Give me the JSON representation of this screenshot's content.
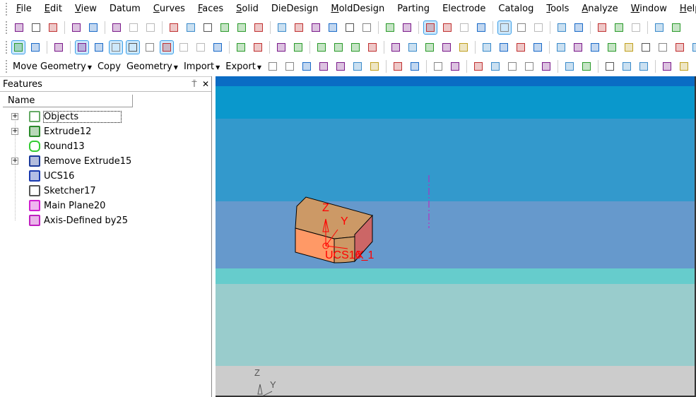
{
  "menu": [
    {
      "label": "File",
      "u": "F",
      "rest": "ile"
    },
    {
      "label": "Edit",
      "u": "E",
      "rest": "dit"
    },
    {
      "label": "View",
      "u": "V",
      "rest": "iew"
    },
    {
      "label": "Datum",
      "u": "",
      "rest": "Datum"
    },
    {
      "label": "Curves",
      "u": "C",
      "rest": "urves"
    },
    {
      "label": "Faces",
      "u": "F",
      "rest": "aces"
    },
    {
      "label": "Solid",
      "u": "S",
      "rest": "olid"
    },
    {
      "label": "DieDesign",
      "u": "",
      "rest": "DieDesign"
    },
    {
      "label": "MoldDesign",
      "u": "M",
      "rest": "oldDesign"
    },
    {
      "label": "Parting",
      "u": "",
      "rest": "Parting"
    },
    {
      "label": "Electrode",
      "u": "",
      "rest": "Electrode"
    },
    {
      "label": "Catalog",
      "u": "",
      "rest": "Catalog"
    },
    {
      "label": "Tools",
      "u": "T",
      "rest": "ools"
    },
    {
      "label": "Analyze",
      "u": "A",
      "rest": "nalyze"
    },
    {
      "label": "Window",
      "u": "W",
      "rest": "indow"
    },
    {
      "label": "Help",
      "u": "H",
      "rest": "elp"
    }
  ],
  "toolbar_row1": [
    "new-file",
    "open-folder",
    "save",
    "sep",
    "undo",
    "redo",
    "sep",
    "view-link",
    "copy-gray",
    "delete-gray",
    "sep",
    "zoom-window",
    "zoom-select",
    "zoom-in",
    "zoom",
    "pan",
    "rotate",
    "sep",
    "shaded-purple",
    "wire-purple",
    "solid-purple",
    "wire",
    "wire-2",
    "wire-3",
    "sep",
    "lock-view",
    "camera",
    "sep",
    "box-active",
    "box-green",
    "box-gray",
    "box-select",
    "sep",
    "light-active",
    "bulb-yellow",
    "bulb-gray",
    "sep",
    "arrow-left",
    "arrow-right",
    "sep",
    "points",
    "dimension",
    "view-gray",
    "sep",
    "color-table",
    "paint"
  ],
  "toolbar_row2": [
    "select-box",
    "deselect",
    "sep",
    "select-window",
    "sep",
    "filter-face",
    "filter-edge",
    "filter-surface",
    "filter-curve",
    "filter-point",
    "filter-plane",
    "filter-gray",
    "filter-gray-2",
    "list",
    "sep",
    "ucs",
    "funnel",
    "sep",
    "sketch",
    "profile",
    "sep",
    "point",
    "line",
    "arc",
    "circle",
    "sep",
    "fillet",
    "trim",
    "extend",
    "cut",
    "split",
    "sep",
    "project",
    "cylinder",
    "wrap",
    "offset",
    "sep",
    "g1",
    "g2",
    "g3",
    "g4",
    "g5",
    "g6",
    "g7",
    "g8",
    "g9"
  ],
  "toolbar_row3": {
    "labels": [
      "Move Geometry",
      "Copy",
      "Geometry",
      "Import",
      "Export"
    ],
    "icons": [
      "sweep",
      "loft",
      "surface",
      "ruled",
      "extrude-surf",
      "plane-surf",
      "draft",
      "sep",
      "mirror",
      "mirror-2",
      "sep",
      "split-face",
      "split-face-2",
      "sep",
      "box-dots",
      "box-edit",
      "patch",
      "fill",
      "offset-surface",
      "sep",
      "extrude-add",
      "extrude-add-2",
      "sep",
      "shell",
      "thicken",
      "cavity",
      "sep",
      "round",
      "chamfer",
      "face-move",
      "sep",
      "blend",
      "blend-2"
    ]
  },
  "panel": {
    "title": "Features",
    "pin": "⍑",
    "close": "✕",
    "column": "Name"
  },
  "features": [
    {
      "label": "Objects",
      "expandable": true,
      "selected": true,
      "icon": "objects-icon",
      "color": "#6a6"
    },
    {
      "label": "Extrude12",
      "expandable": true,
      "icon": "extrude-icon",
      "color": "#2a8a2a"
    },
    {
      "label": "Round13",
      "expandable": false,
      "icon": "round-icon",
      "color": "#3c3"
    },
    {
      "label": "Remove Extrude15",
      "expandable": true,
      "icon": "remove-extrude-icon",
      "color": "#1a3a9a"
    },
    {
      "label": "UCS16",
      "expandable": false,
      "icon": "ucs-icon",
      "color": "#1a3ab0"
    },
    {
      "label": "Sketcher17",
      "expandable": false,
      "icon": "sketcher-icon",
      "color": "#555"
    },
    {
      "label": "Main Plane20",
      "expandable": false,
      "icon": "plane-icon",
      "color": "#d020d0"
    },
    {
      "label": "Axis-Defined by25",
      "expandable": false,
      "icon": "axis-icon",
      "color": "#c020c0"
    }
  ],
  "viewport": {
    "ucs_label": "UCS16_1",
    "axis_z": "Z",
    "axis_y": "Y",
    "axis_x": "X",
    "triad_z": "Z",
    "triad_y": "Y",
    "colors": {
      "accent": "#ff0000",
      "top_face": "#cc9966",
      "front_face": "#ff9966",
      "side_face": "#cc6666"
    }
  }
}
